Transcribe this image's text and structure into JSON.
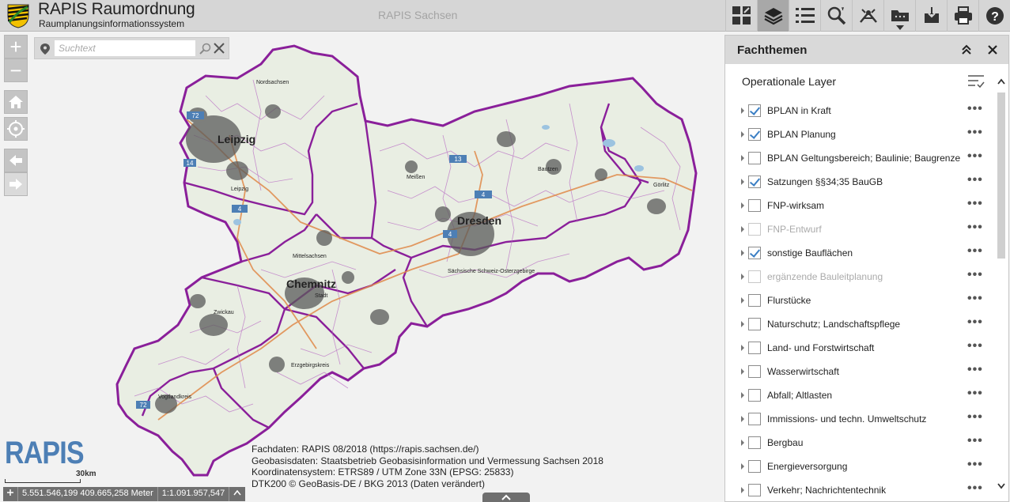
{
  "header": {
    "app_title": "RAPIS Raumordnung",
    "app_subtitle": "Raumplanungsinformationssystem",
    "center_title": "RAPIS Sachsen",
    "toolbar_icons": [
      "basemap-gallery-icon",
      "layers-icon",
      "layer-list-icon",
      "search-icon",
      "measure-icon",
      "bookmark-icon",
      "edit-icon",
      "print-icon",
      "help-icon"
    ]
  },
  "search": {
    "placeholder": "Suchtext"
  },
  "map": {
    "zoom_in": "+",
    "zoom_out": "−",
    "place_labels": [
      {
        "text": "Nordsachsen"
      },
      {
        "text": "Leipzig"
      },
      {
        "text": "Meißen"
      },
      {
        "text": "Bautzen"
      },
      {
        "text": "Görlitz"
      },
      {
        "text": "Dresden"
      },
      {
        "text": "Mittelsachsen"
      },
      {
        "text": "Chemnitz"
      },
      {
        "text": "Stadt"
      },
      {
        "text": "Sächsische Schweiz-Osterzgebirge"
      },
      {
        "text": "Zwickau"
      },
      {
        "text": "Erzgebirgskreis"
      },
      {
        "text": "Vogtlandkreis"
      },
      {
        "text": "Leipzig"
      }
    ],
    "road_shields": [
      "72",
      "14",
      "4",
      "13",
      "4",
      "4",
      "72"
    ],
    "rapis_logo": "RAPIS",
    "scale_label": "30km",
    "coordinates": "5.551.546,199 409.665,258 Meter",
    "scale_ratio": "1:1.091.957,547",
    "attribution": [
      "Fachdaten: RAPIS 08/2018 (https://rapis.sachsen.de/)",
      "Geobasisdaten: Staatsbetrieb Geobasisinformation und Vermessung Sachsen 2018",
      "Koordinatensystem: ETRS89 / UTM Zone 33N (EPSG: 25833)",
      "DTK200 © GeoBasis-DE / BKG 2013 (Daten verändert)"
    ]
  },
  "panel": {
    "title": "Fachthemen",
    "section_title": "Operationale Layer",
    "layers": [
      {
        "label": "BPLAN in Kraft",
        "checked": true,
        "dim": false
      },
      {
        "label": "BPLAN Planung",
        "checked": true,
        "dim": false
      },
      {
        "label": "BPLAN Geltungsbereich; Baulinie; Baugrenze",
        "checked": false,
        "dim": false
      },
      {
        "label": "Satzungen §§34;35 BauGB",
        "checked": true,
        "dim": false
      },
      {
        "label": "FNP-wirksam",
        "checked": false,
        "dim": false
      },
      {
        "label": "FNP-Entwurf",
        "checked": false,
        "dim": true
      },
      {
        "label": "sonstige Bauflächen",
        "checked": true,
        "dim": false
      },
      {
        "label": "ergänzende Bauleitplanung",
        "checked": false,
        "dim": true
      },
      {
        "label": "Flurstücke",
        "checked": false,
        "dim": false
      },
      {
        "label": "Naturschutz; Landschaftspflege",
        "checked": false,
        "dim": false
      },
      {
        "label": "Land- und Forstwirtschaft",
        "checked": false,
        "dim": false
      },
      {
        "label": "Wasserwirtschaft",
        "checked": false,
        "dim": false
      },
      {
        "label": "Abfall; Altlasten",
        "checked": false,
        "dim": false
      },
      {
        "label": "Immissions- und techn. Umweltschutz",
        "checked": false,
        "dim": false
      },
      {
        "label": "Bergbau",
        "checked": false,
        "dim": false
      },
      {
        "label": "Energieversorgung",
        "checked": false,
        "dim": false
      },
      {
        "label": "Verkehr; Nachrichtentechnik",
        "checked": false,
        "dim": false
      }
    ],
    "more_label": "•••"
  },
  "colors": {
    "header_bg": "#d6d6d6",
    "border_purple": "#8a1f9a",
    "check_blue": "#3b7fc4",
    "rapis_blue": "#4d7fb5"
  }
}
